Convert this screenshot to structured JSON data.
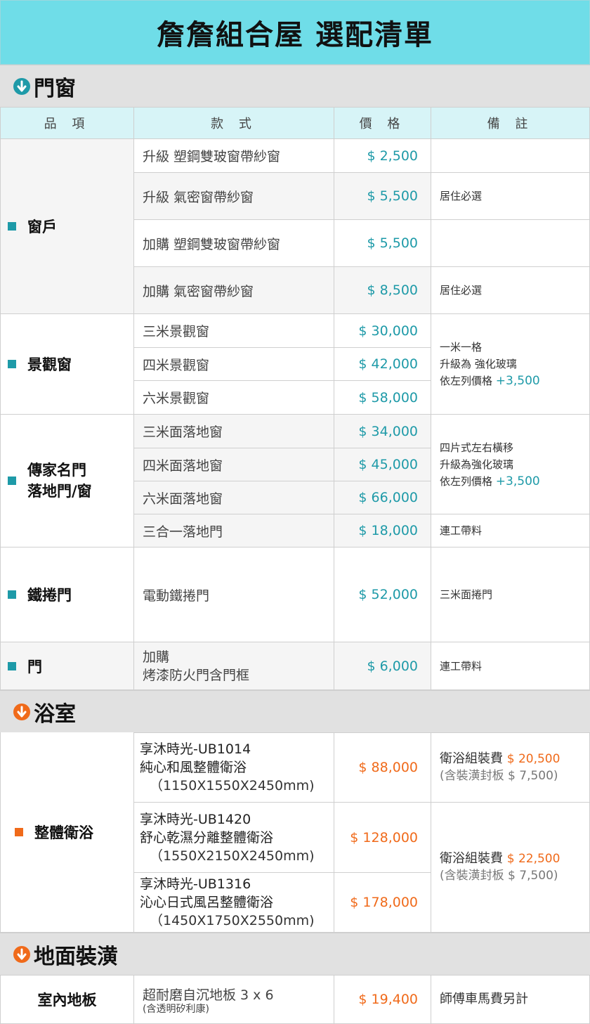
{
  "title": "詹詹組合屋  選配清單",
  "colors": {
    "teal": "#1e9aa8",
    "orange": "#f06a1a",
    "title_bg": "#6fdde8"
  },
  "sections": {
    "doors_windows": {
      "title": "門窗",
      "icon": "down-arrow-circle-icon",
      "headers": [
        "品 項",
        "款 式",
        "價 格",
        "備 註"
      ],
      "windows": {
        "category": "窗戶",
        "rows": [
          {
            "style": "升級  塑鋼雙玻窗帶紗窗",
            "price": "$ 2,500",
            "note": ""
          },
          {
            "style": "升級   氣密窗帶紗窗",
            "price": "$ 5,500",
            "note": "居住必選"
          },
          {
            "style": "加購  塑鋼雙玻窗帶紗窗",
            "price": "$ 5,500",
            "note": ""
          },
          {
            "style": "加購   氣密窗帶紗窗",
            "price": "$ 8,500",
            "note": "居住必選"
          }
        ]
      },
      "view_windows": {
        "category": "景觀窗",
        "rows": [
          {
            "style": "三米景觀窗",
            "price": "$ 30,000"
          },
          {
            "style": "四米景觀窗",
            "price": "$ 42,000"
          },
          {
            "style": "六米景觀窗",
            "price": "$ 58,000"
          }
        ],
        "note_line1": "一米一格",
        "note_line2": "升級為 強化玻璃",
        "note_line3": "依左列價格",
        "note_extra": "+3,500"
      },
      "heritage": {
        "category_line1": "傳家名門",
        "category_line2": "落地門/窗",
        "rows": [
          {
            "style": "三米面落地窗",
            "price": "$ 34,000"
          },
          {
            "style": "四米面落地窗",
            "price": "$ 45,000"
          },
          {
            "style": "六米面落地窗",
            "price": "$ 66,000"
          },
          {
            "style": "三合一落地門",
            "price": "$ 18,000",
            "note": "連工帶料"
          }
        ],
        "note_line1": "四片式左右橫移",
        "note_line2": "升級為強化玻璃",
        "note_line3": "依左列價格",
        "note_extra": "+3,500"
      },
      "rolling_door": {
        "category": "鐵捲門",
        "style": "電動鐵捲門",
        "price": "$ 52,000",
        "note": "三米面捲門"
      },
      "door": {
        "category": "門",
        "style_line1": "加購",
        "style_line2": "烤漆防火門含門框",
        "price": "$ 6,000",
        "note": "連工帶料"
      }
    },
    "bathroom": {
      "title": "浴室",
      "icon": "down-arrow-circle-icon",
      "category": "整體衛浴",
      "rows": [
        {
          "line1": "享沐時光-UB1014",
          "line2": "純心和風整體衛浴",
          "line3": "（1150X1550X2450mm)",
          "price": "$ 88,000"
        },
        {
          "line1": "享沐時光-UB1420",
          "line2": "舒心乾濕分離整體衛浴",
          "line3": "（1550X2150X2450mm)",
          "price": "$ 128,000"
        },
        {
          "line1": "享沐時光-UB1316",
          "line2": "沁心日式風呂整體衛浴",
          "line3": "（1450X1750X2550mm)",
          "price": "$ 178,000"
        }
      ],
      "note1_label": "衛浴組裝費",
      "note1_fee": "$ 20,500",
      "note1_sub": "(含裝潢封板 $ 7,500)",
      "note2_label": "衛浴組裝費",
      "note2_fee": "$ 22,500",
      "note2_sub": "(含裝潢封板 $ 7,500)"
    },
    "flooring": {
      "title": "地面裝潢",
      "icon": "down-arrow-circle-icon",
      "category": "室內地板",
      "style_line1": "超耐磨自沉地板  3 x 6",
      "style_line2": "(含透明矽利康)",
      "price": "$ 19,400",
      "note": "師傅車馬費另計"
    }
  }
}
